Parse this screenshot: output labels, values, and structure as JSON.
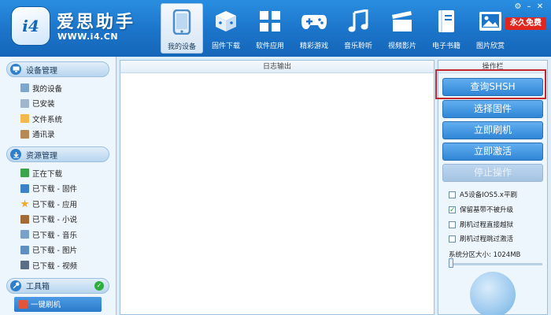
{
  "app": {
    "name": "爱思助手",
    "url": "WWW.i4.CN",
    "logo_text": "i4",
    "vip_badge": "永久免费"
  },
  "nav": [
    {
      "label": "我的设备",
      "icon": "phone-icon",
      "active": true
    },
    {
      "label": "固件下载",
      "icon": "box-icon",
      "active": false
    },
    {
      "label": "软件应用",
      "icon": "apps-grid-icon",
      "active": false
    },
    {
      "label": "精彩游戏",
      "icon": "gamepad-icon",
      "active": false
    },
    {
      "label": "音乐聆听",
      "icon": "music-note-icon",
      "active": false
    },
    {
      "label": "视频影片",
      "icon": "clapperboard-icon",
      "active": false
    },
    {
      "label": "电子书籍",
      "icon": "book-icon",
      "active": false
    },
    {
      "label": "图片欣赏",
      "icon": "picture-icon",
      "active": false
    }
  ],
  "sidebar": {
    "sections": [
      {
        "label": "设备管理",
        "icon": "monitor-icon",
        "items": [
          {
            "label": "我的设备",
            "icon": "device-icon",
            "color": "#7fa6cf"
          },
          {
            "label": "已安装",
            "icon": "installed-icon",
            "color": "#9fb6cc"
          },
          {
            "label": "文件系统",
            "icon": "folder-icon",
            "color": "#f2b84b"
          },
          {
            "label": "通讯录",
            "icon": "contacts-icon",
            "color": "#b58a57"
          }
        ]
      },
      {
        "label": "资源管理",
        "icon": "download-cloud-icon",
        "items": [
          {
            "label": "正在下载",
            "icon": "download-icon",
            "color": "#3ca44a"
          },
          {
            "label": "已下载 - 固件",
            "icon": "ios-icon",
            "color": "#3b82c9"
          },
          {
            "label": "已下载 - 应用",
            "icon": "star-icon",
            "color": "#f0a92a"
          },
          {
            "label": "已下载 - 小说",
            "icon": "novel-icon",
            "color": "#a26b35"
          },
          {
            "label": "已下载 - 音乐",
            "icon": "music-icon",
            "color": "#7aa1c7"
          },
          {
            "label": "已下载 - 图片",
            "icon": "image-icon",
            "color": "#5d8fc0"
          },
          {
            "label": "已下载 - 视频",
            "icon": "video-icon",
            "color": "#5a6f85"
          }
        ]
      },
      {
        "label": "工具箱",
        "icon": "wrench-icon",
        "items": [
          {
            "label": "一键刷机",
            "icon": "flash-icon",
            "color": "#e2553a",
            "active": true
          }
        ]
      }
    ]
  },
  "log": {
    "title": "日志输出"
  },
  "operations": {
    "title": "操作栏",
    "buttons": [
      {
        "label": "查询SHSH",
        "enabled": true
      },
      {
        "label": "选择固件",
        "enabled": true
      },
      {
        "label": "立即刷机",
        "enabled": true
      },
      {
        "label": "立即激活",
        "enabled": true
      },
      {
        "label": "停止操作",
        "enabled": false
      }
    ],
    "options": [
      {
        "label": "A5设备IOS5.x平刷",
        "checked": false
      },
      {
        "label": "保留基带不被升级",
        "checked": true
      },
      {
        "label": "刷机过程直接越狱",
        "checked": false
      },
      {
        "label": "刷机过程跳过激活",
        "checked": false
      }
    ],
    "partition_label": "系统分区大小: ",
    "partition_value": "1024MB"
  },
  "colors": {
    "header": "#1b74c9",
    "button": "#2f86d6",
    "highlight": "#c4282e",
    "vip": "#e0261f"
  }
}
